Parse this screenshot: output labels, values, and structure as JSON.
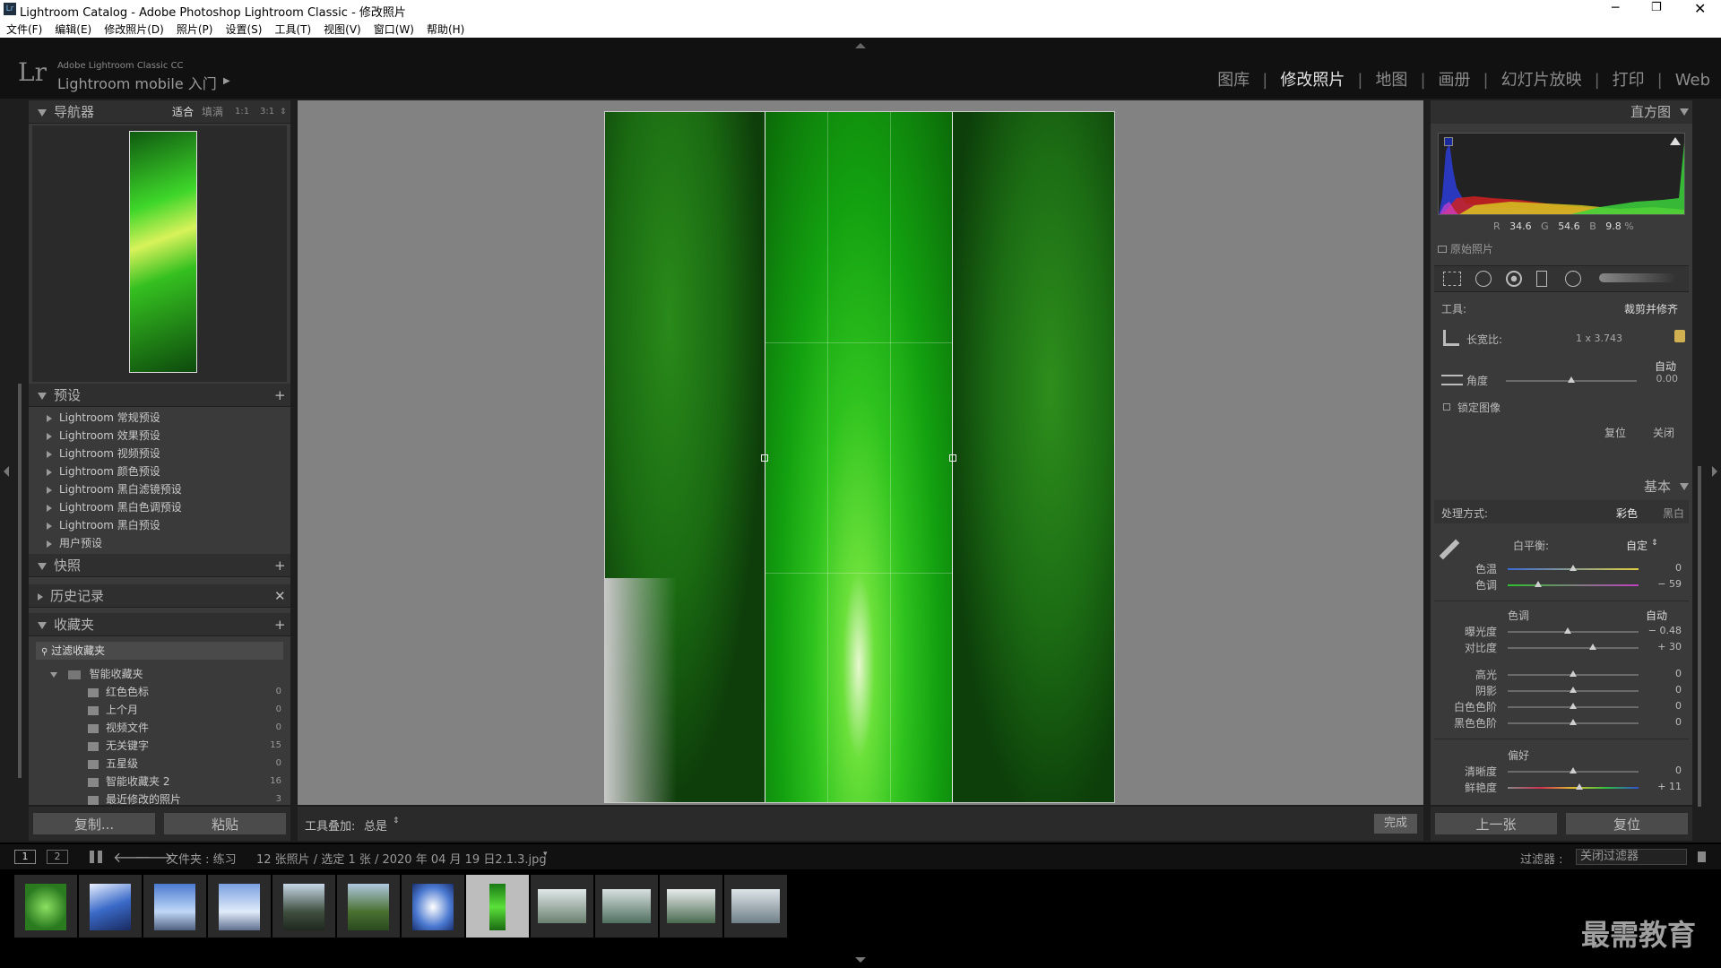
{
  "window": {
    "title": "Lightroom Catalog - Adobe Photoshop Lightroom Classic - 修改照片"
  },
  "menu": [
    "文件(F)",
    "编辑(E)",
    "修改照片(D)",
    "照片(P)",
    "设置(S)",
    "工具(T)",
    "视图(V)",
    "窗口(W)",
    "帮助(H)"
  ],
  "identity": {
    "brand": "Lr",
    "product": "Adobe Lightroom Classic CC",
    "mobile": "Lightroom mobile 入门"
  },
  "modules": [
    "图库",
    "修改照片",
    "地图",
    "画册",
    "幻灯片放映",
    "打印",
    "Web"
  ],
  "active_module": "修改照片",
  "navigator": {
    "title": "导航器",
    "zoom": [
      "适合",
      "填满",
      "1:1",
      "3:1"
    ]
  },
  "presets": {
    "title": "预设",
    "items": [
      "Lightroom 常规预设",
      "Lightroom 效果预设",
      "Lightroom 视频预设",
      "Lightroom 颜色预设",
      "Lightroom 黑白滤镜预设",
      "Lightroom 黑白色调预设",
      "Lightroom 黑白预设",
      "用户预设"
    ]
  },
  "snapshots": {
    "title": "快照"
  },
  "history": {
    "title": "历史记录"
  },
  "collections": {
    "title": "收藏夹",
    "filter_placeholder": "过滤收藏夹",
    "group": "智能收藏夹",
    "items": [
      {
        "name": "红色色标",
        "count": "0"
      },
      {
        "name": "上个月",
        "count": "0"
      },
      {
        "name": "视频文件",
        "count": "0"
      },
      {
        "name": "无关键字",
        "count": "15"
      },
      {
        "name": "五星级",
        "count": "0"
      },
      {
        "name": "智能收藏夹 2",
        "count": "16"
      },
      {
        "name": "最近修改的照片",
        "count": "3"
      }
    ]
  },
  "left_buttons": {
    "copy": "复制...",
    "paste": "粘贴"
  },
  "toolbar": {
    "overlay_label": "工具叠加:",
    "overlay_value": "总是",
    "done": "完成"
  },
  "histogram": {
    "title": "直方图",
    "r_label": "R",
    "r": "34.6",
    "g_label": "G",
    "g": "54.6",
    "b_label": "B",
    "b": "9.8",
    "unit": "%",
    "original": "原始照片"
  },
  "crop": {
    "tool_label": "工具:",
    "tool_name": "裁剪并修齐",
    "aspect_label": "长宽比:",
    "aspect_value": "1 x 3.743",
    "auto": "自动",
    "angle_label": "角度",
    "angle_value": "0.00",
    "angle_level": 0.5,
    "lock_label": "锁定图像",
    "reset": "复位",
    "close": "关闭"
  },
  "basic": {
    "title": "基本",
    "treatment_label": "处理方式:",
    "color": "彩色",
    "bw": "黑白",
    "wb_label": "白平衡:",
    "wb_value": "自定",
    "temp_label": "色温",
    "temp_value": "0",
    "temp_level": 0.5,
    "tint_label": "色调",
    "tint_value": "− 59",
    "tint_level": 0.23,
    "tone_header": "色调",
    "tone_auto": "自动",
    "exposure_label": "曝光度",
    "exposure_value": "− 0.48",
    "exposure_level": 0.46,
    "contrast_label": "对比度",
    "contrast_value": "+ 30",
    "contrast_level": 0.65,
    "highlights_label": "高光",
    "highlights_value": "0",
    "highlights_level": 0.5,
    "shadows_label": "阴影",
    "shadows_value": "0",
    "shadows_level": 0.5,
    "whites_label": "白色色阶",
    "whites_value": "0",
    "whites_level": 0.5,
    "blacks_label": "黑色色阶",
    "blacks_value": "0",
    "blacks_level": 0.5,
    "presence_header": "偏好",
    "clarity_label": "清晰度",
    "clarity_value": "0",
    "clarity_level": 0.5,
    "vibrance_label": "鲜艳度",
    "vibrance_value": "+ 11",
    "vibrance_level": 0.55
  },
  "right_buttons": {
    "prev": "上一张",
    "reset": "复位"
  },
  "filmstrip_bar": {
    "view1": "1",
    "view2": "2",
    "source": "文件夹 : 练习",
    "info": "12 张照片 / 选定 1 张 / 2020 年 04 月 19 日2.1.3.jpg",
    "filter_label": "过滤器 :",
    "filter_value": "关闭过滤器"
  },
  "watermark": "最需教育",
  "colors": {
    "accent_green": "#2fa82a",
    "panel_bg": "#3a3a3a"
  }
}
